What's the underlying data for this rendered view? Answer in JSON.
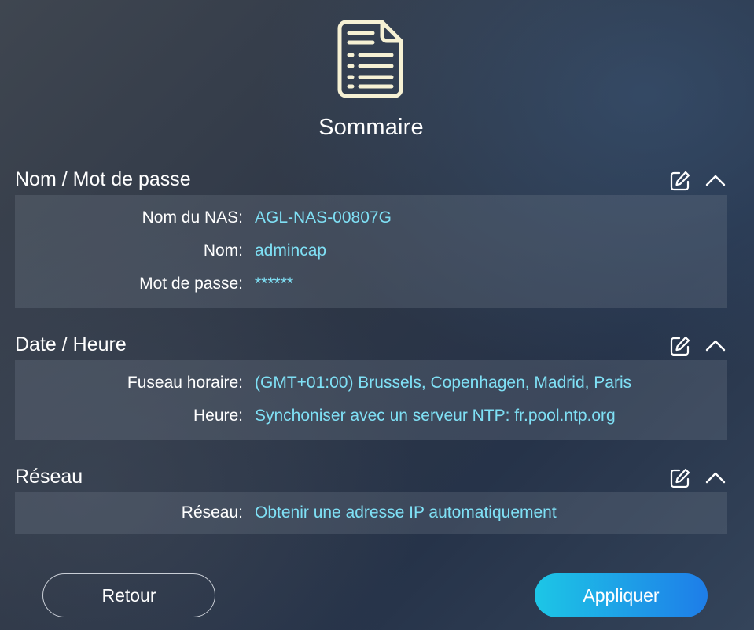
{
  "page": {
    "title": "Sommaire",
    "header_icon": "document-list-icon"
  },
  "colors": {
    "value_text": "#7fe0f5",
    "apply_gradient_start": "#1dc6e6",
    "apply_gradient_end": "#1e7de8",
    "icon_stroke": "#f6f1d4"
  },
  "sections": [
    {
      "title": "Nom / Mot de passe",
      "rows": [
        {
          "label": "Nom du NAS:",
          "value": "AGL-NAS-00807G"
        },
        {
          "label": "Nom:",
          "value": "admincap"
        },
        {
          "label": "Mot de passe:",
          "value": "******"
        }
      ]
    },
    {
      "title": "Date / Heure",
      "rows": [
        {
          "label": "Fuseau horaire:",
          "value": "(GMT+01:00) Brussels, Copenhagen, Madrid, Paris"
        },
        {
          "label": "Heure:",
          "value": "Synchoniser avec un serveur NTP: fr.pool.ntp.org"
        }
      ]
    },
    {
      "title": "Réseau",
      "rows": [
        {
          "label": "Réseau:",
          "value": "Obtenir une adresse IP automatiquement"
        }
      ]
    }
  ],
  "buttons": {
    "back_label": "Retour",
    "apply_label": "Appliquer"
  }
}
